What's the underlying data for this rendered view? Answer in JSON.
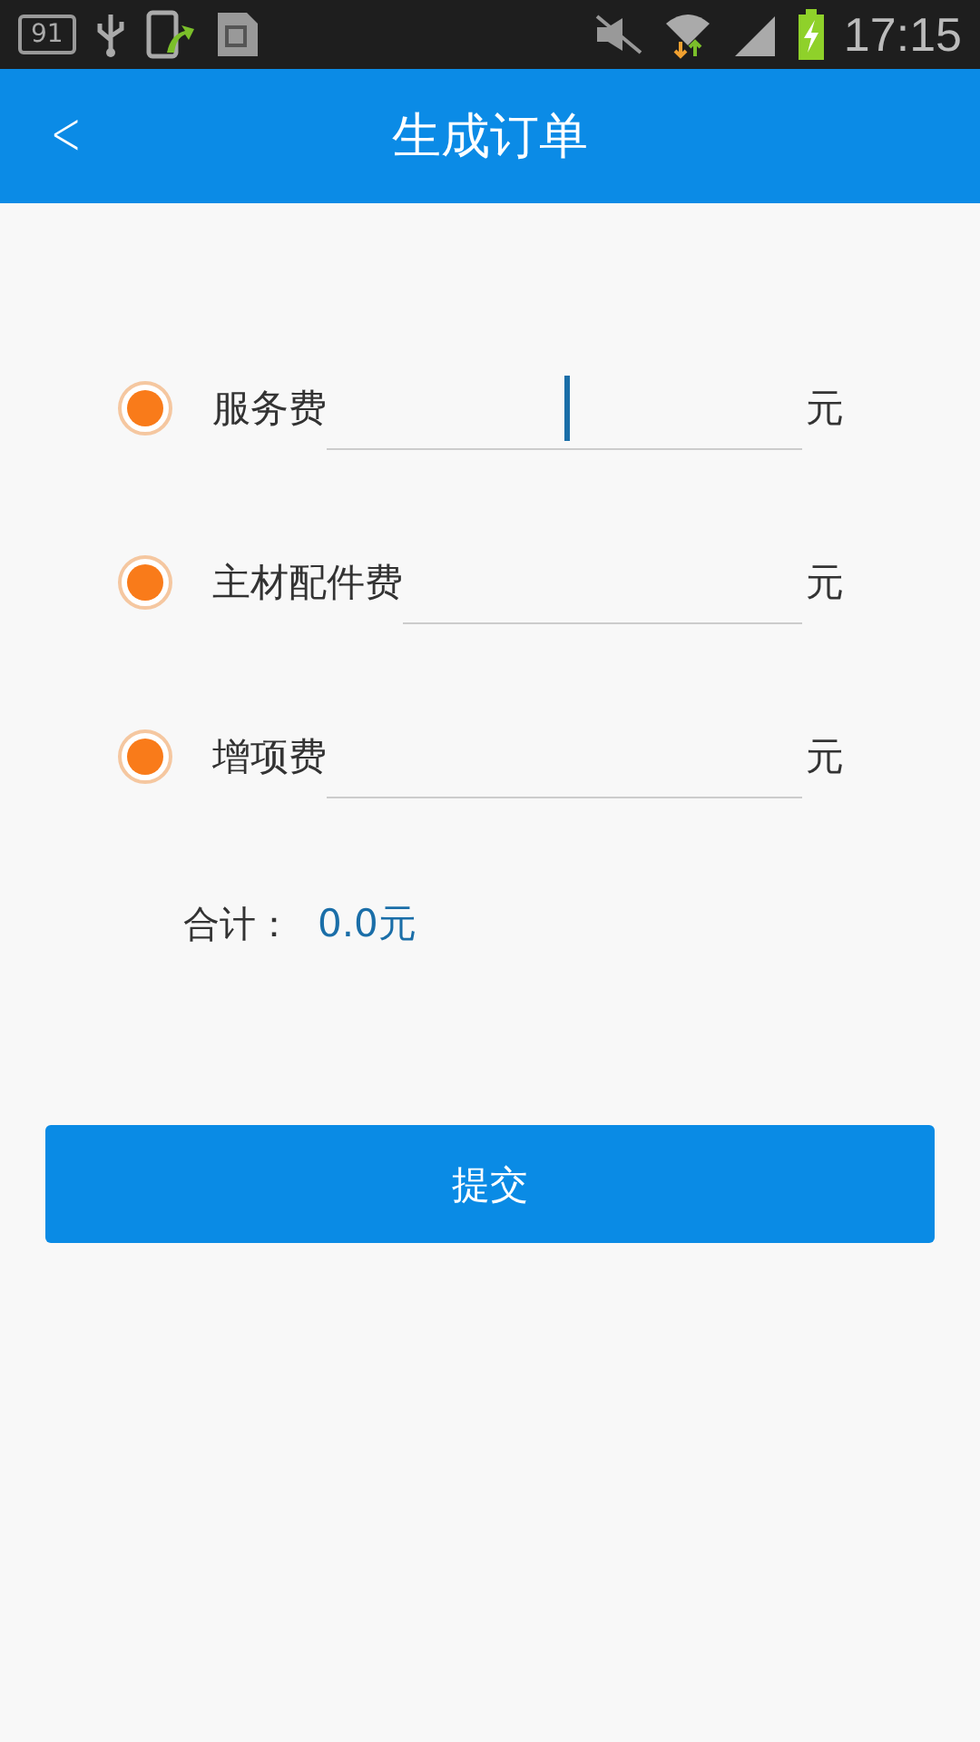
{
  "status_bar": {
    "notification_badge": "91",
    "time": "17:15"
  },
  "header": {
    "back_icon": "<",
    "title": "生成订单"
  },
  "fields": [
    {
      "label": "服务费",
      "unit": "元",
      "selected": true,
      "focused": true
    },
    {
      "label": "主材配件费",
      "unit": "元",
      "selected": true,
      "focused": false
    },
    {
      "label": "增项费",
      "unit": "元",
      "selected": true,
      "focused": false
    }
  ],
  "total": {
    "label": "合计：",
    "value": "0.0元"
  },
  "submit_button": "提交"
}
